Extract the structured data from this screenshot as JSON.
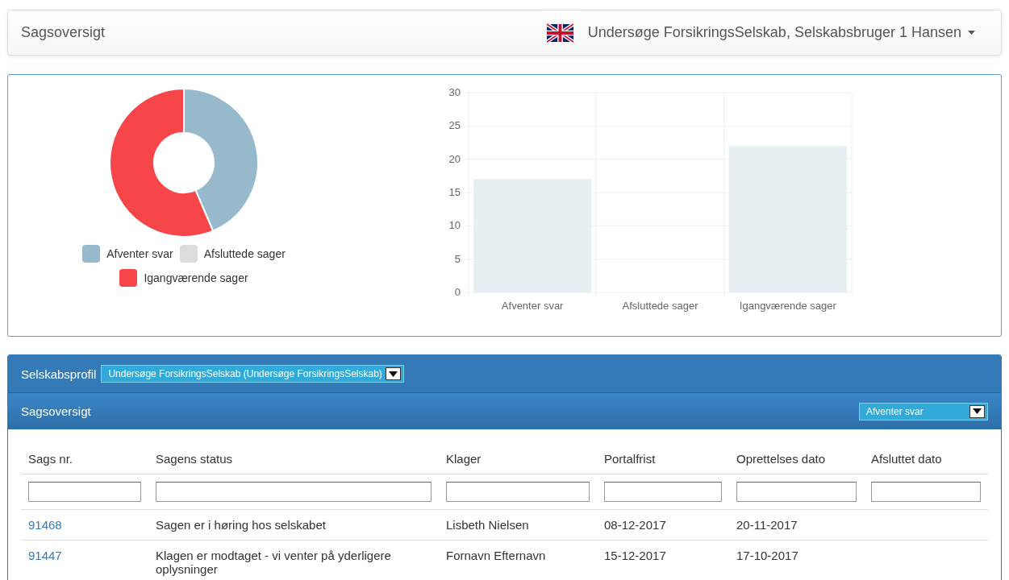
{
  "navbar": {
    "title": "Sagsoversigt",
    "user_menu": "Undersøge ForsikringsSelskab, Selskabsbruger 1 Hansen"
  },
  "donut": {
    "chart_data": {
      "type": "donut",
      "categories": [
        "Afventer svar",
        "Afsluttede sager",
        "Igangværende sager"
      ],
      "values": [
        43.6,
        0,
        56.4
      ]
    },
    "legend": [
      {
        "color": "#97b9cc"
      },
      {
        "color": "#dcdcdc"
      },
      {
        "color": "#f7464a"
      }
    ]
  },
  "bar": {
    "chart_data": {
      "type": "bar",
      "categories": [
        "Afventer svar",
        "Afsluttede sager",
        "Igangværende sager"
      ],
      "series": [
        {
          "color": "#e8eff3",
          "values": [
            17,
            0,
            22
          ]
        }
      ],
      "ylim": [
        0,
        30
      ],
      "yticks": [
        0,
        5,
        10,
        15,
        20,
        25,
        30
      ],
      "grid": true
    }
  },
  "profile_bar": {
    "label": "Selskabsprofil",
    "select": "Undersøge ForsikringsSelskab (Undersøge ForsikringsSelskab)"
  },
  "case_panel": {
    "title": "Sagsoversigt",
    "filter": "Afventer svar"
  },
  "table": {
    "columns": [
      "Sags nr.",
      "Sagens status",
      "Klager",
      "Portalfrist",
      "Oprettelses dato",
      "Afsluttet dato"
    ],
    "rows": [
      [
        "91468",
        "Sagen er i høring hos selskabet",
        "Lisbeth Nielsen",
        "08-12-2017",
        "20-11-2017",
        ""
      ],
      [
        "91447",
        "Klagen er modtaget - vi venter på yderligere oplysninger",
        "Fornavn Efternavn",
        "15-12-2017",
        "17-10-2017",
        ""
      ]
    ]
  }
}
